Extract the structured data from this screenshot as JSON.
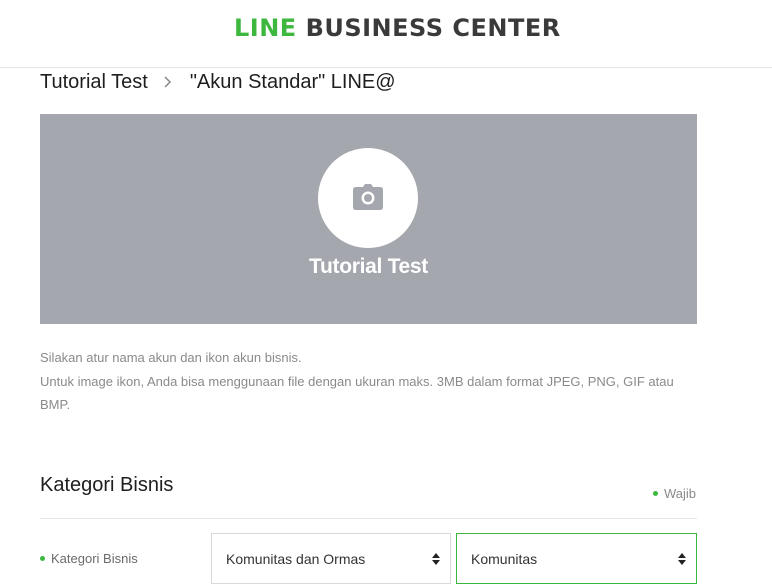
{
  "header": {
    "logo_brand": "LINE",
    "logo_rest": "BUSINESS CENTER"
  },
  "breadcrumb": {
    "items": [
      "Tutorial Test",
      "\"Akun Standar\" LINE@"
    ]
  },
  "cover": {
    "account_name": "Tutorial Test",
    "upload_icon": "camera-icon"
  },
  "help": {
    "line1": "Silakan atur nama akun dan ikon akun bisnis.",
    "line2": "Untuk image ikon, Anda bisa menggunaan file dengan ukuran maks. 3MB dalam format JPEG, PNG, GIF atau BMP."
  },
  "section": {
    "title": "Kategori Bisnis",
    "required_label": "Wajib"
  },
  "form": {
    "category_label": "Kategori Bisnis",
    "category_value": "Komunitas dan Ormas",
    "subcategory_value": "Komunitas"
  },
  "colors": {
    "brand_green": "#3db73e",
    "cover_gray": "#a4a7ad"
  }
}
